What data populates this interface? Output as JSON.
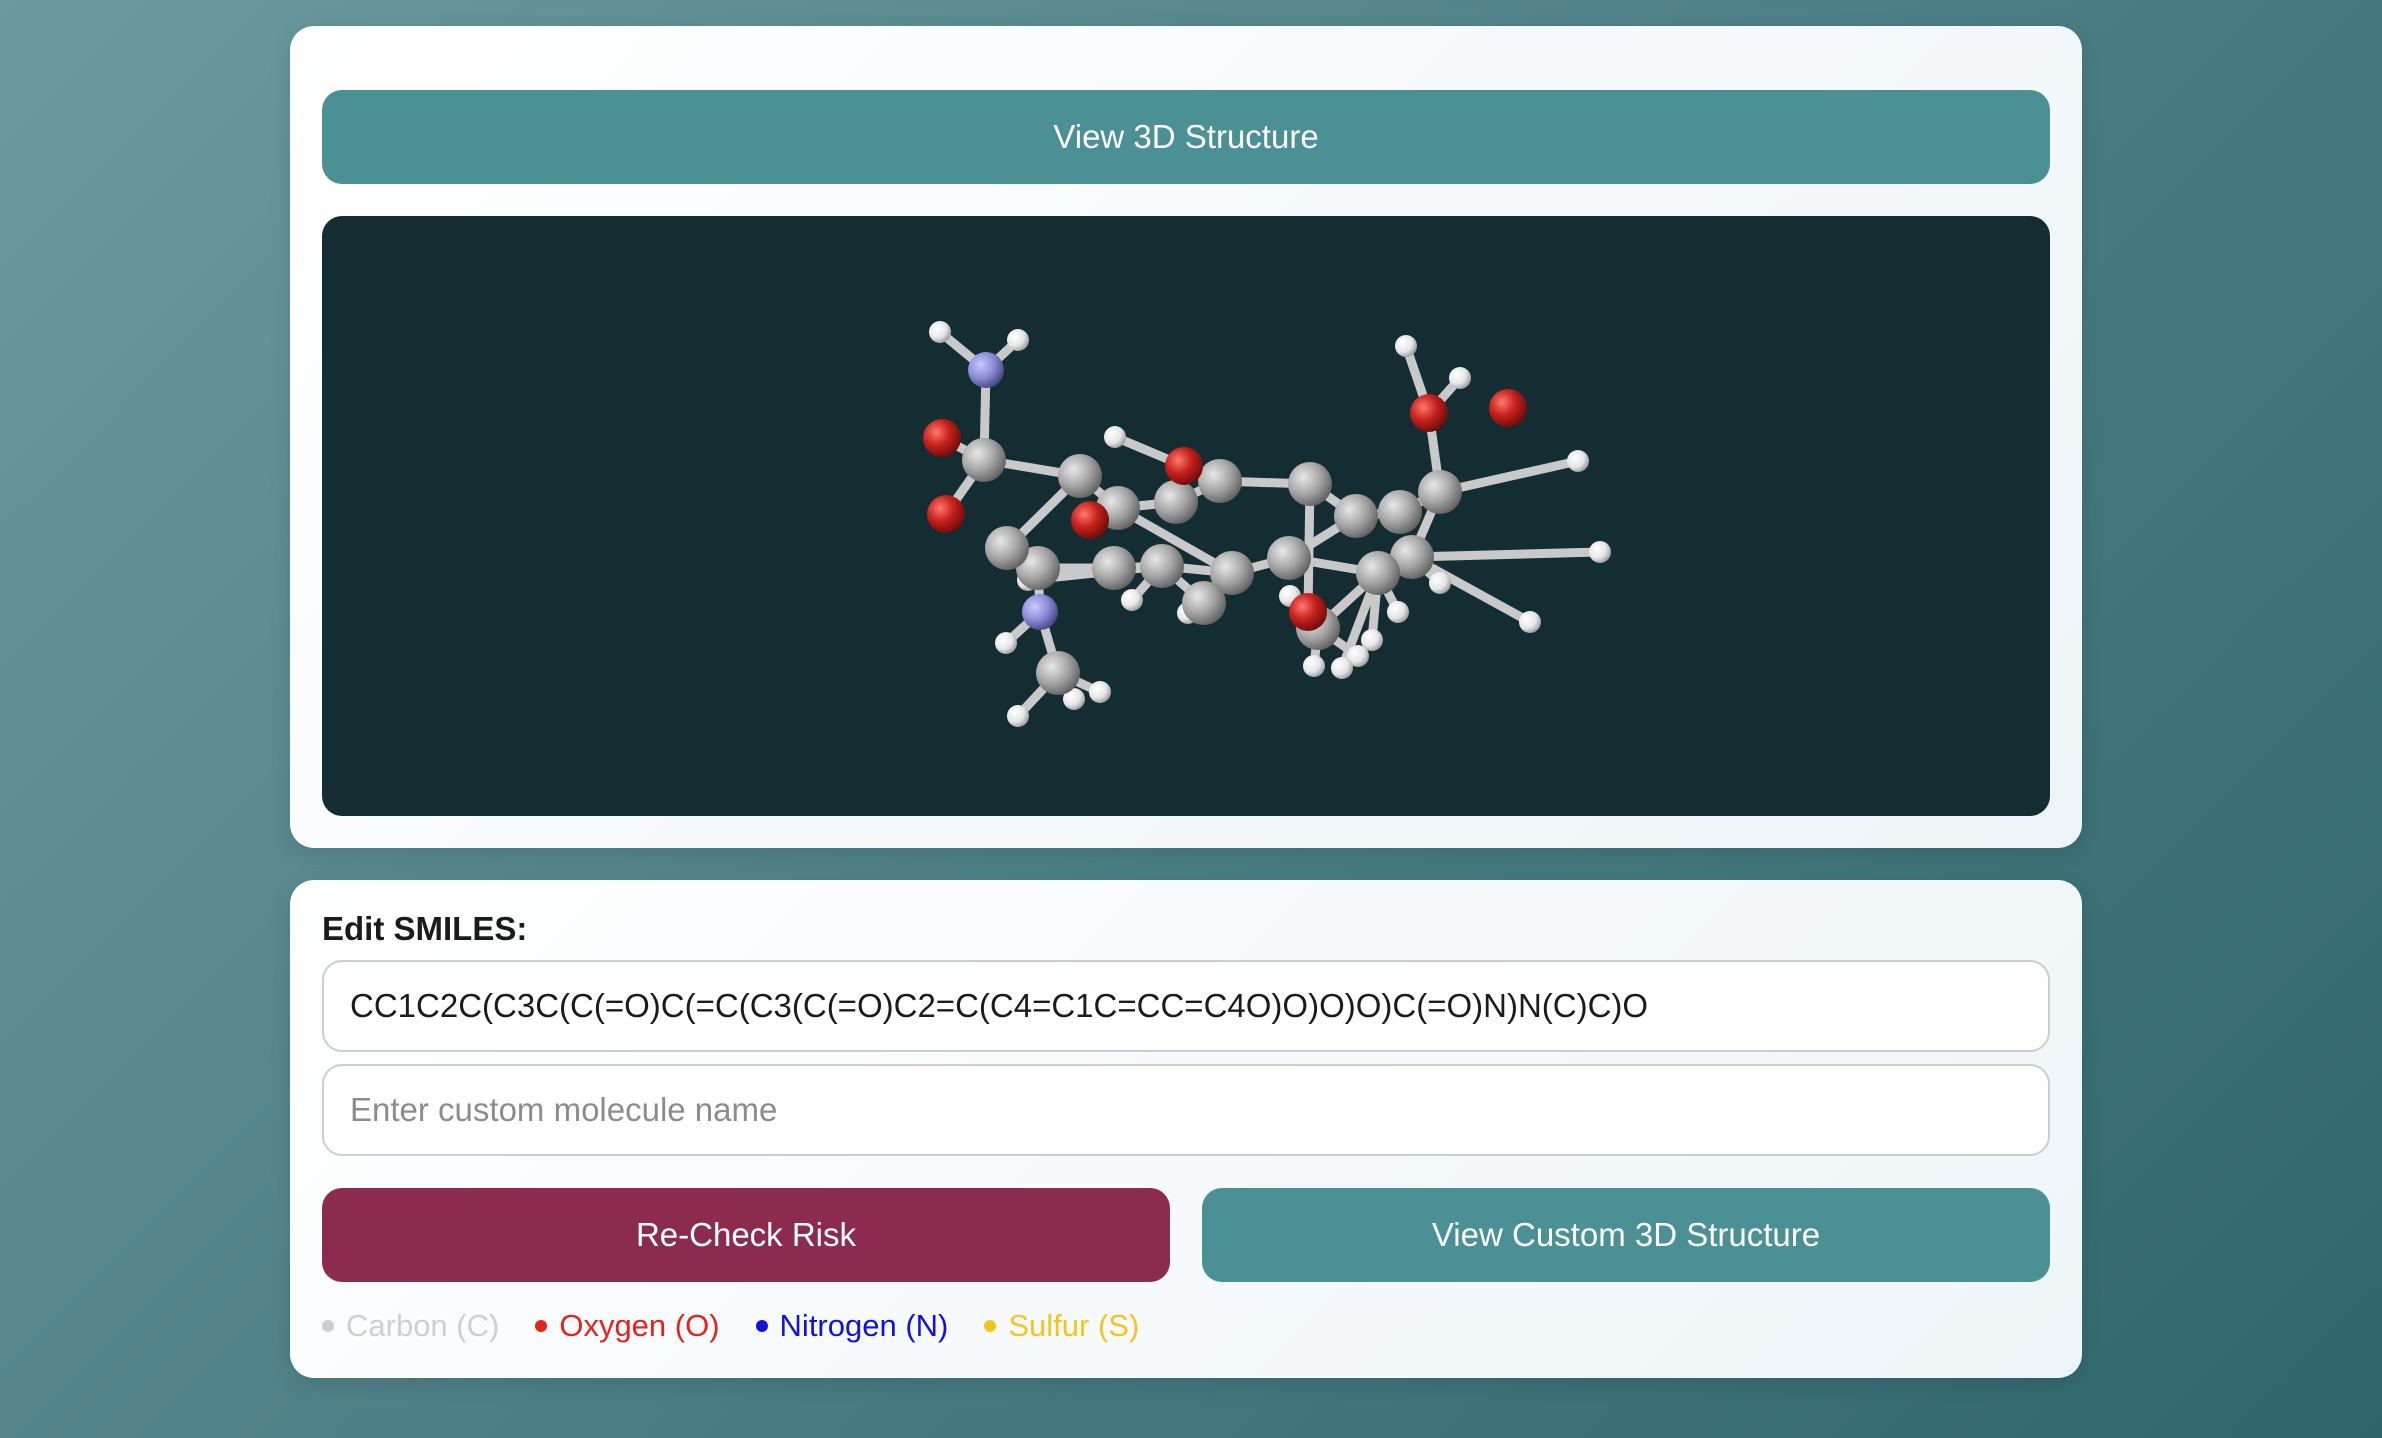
{
  "viewer_card": {
    "view_button_label": "View 3D Structure"
  },
  "edit_card": {
    "smiles_label": "Edit SMILES:",
    "smiles_value": "CC1C2C(C3C(C(=O)C(=C(C3(C(=O)C2=C(C4=C1C=CC=C4O)O)O)O)C(=O)N)N(C)C)O",
    "name_placeholder": "Enter custom molecule name",
    "name_value": "",
    "recheck_label": "Re-Check Risk",
    "view_custom_label": "View Custom 3D Structure"
  },
  "legend": [
    {
      "label": "Carbon (C)",
      "color": "#cfcfcf"
    },
    {
      "label": "Oxygen (O)",
      "color": "#e3231d"
    },
    {
      "label": "Nitrogen (N)",
      "color": "#1313d8"
    },
    {
      "label": "Sulfur (S)",
      "color": "#f2c51d"
    }
  ],
  "colors": {
    "teal_button": "#4a9094",
    "maroon_button": "#8b2c4f",
    "viewer_bg": "#132d33",
    "carbon_atom": "#a9a9a9",
    "oxygen_atom": "#c6201c",
    "nitrogen_atom": "#8a8ad6",
    "hydrogen_atom": "#f2f2f2"
  }
}
